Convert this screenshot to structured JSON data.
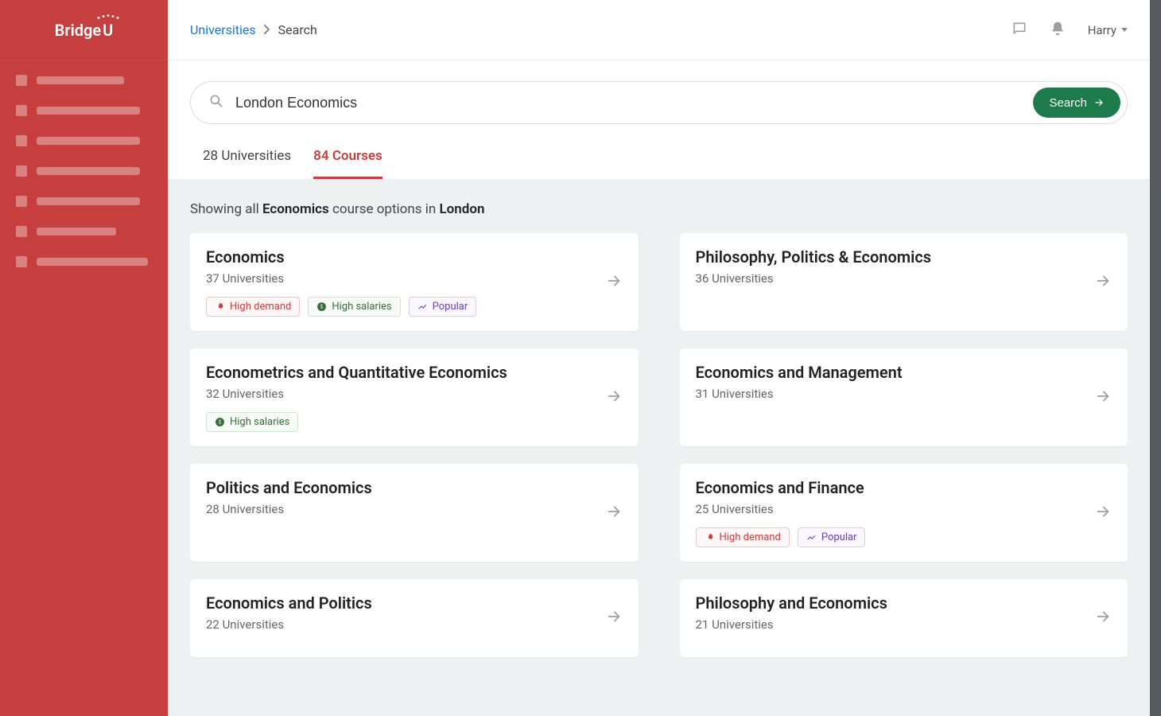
{
  "logo_text": "BridgeU",
  "breadcrumb": {
    "root": "Universities",
    "current": "Search"
  },
  "user": {
    "name": "Harry"
  },
  "search": {
    "value": "London Economics",
    "button": "Search"
  },
  "tabs": {
    "universities_label": "28 Universities",
    "courses_label": "84 Courses"
  },
  "results_heading": {
    "prefix": "Showing all ",
    "subject": "Economics",
    "mid": " course options in ",
    "location": "London"
  },
  "badges": {
    "high_demand": "High demand",
    "high_salaries": "High salaries",
    "popular": "Popular"
  },
  "courses": [
    {
      "title": "Economics",
      "sub": "37 Universities",
      "tags": [
        "demand",
        "salary",
        "popular"
      ]
    },
    {
      "title": "Philosophy, Politics & Economics",
      "sub": "36 Universities",
      "tags": []
    },
    {
      "title": "Econometrics and Quantitative Economics",
      "sub": "32 Universities",
      "tags": [
        "salary"
      ]
    },
    {
      "title": "Economics and Management",
      "sub": "31 Universities",
      "tags": []
    },
    {
      "title": "Politics and Economics",
      "sub": "28 Universities",
      "tags": []
    },
    {
      "title": "Economics and Finance",
      "sub": "25 Universities",
      "tags": [
        "demand",
        "popular"
      ]
    },
    {
      "title": "Economics and Politics",
      "sub": "22 Universities",
      "tags": []
    },
    {
      "title": "Philosophy and Economics",
      "sub": "21 Universities",
      "tags": []
    }
  ],
  "sidebar_nav_widths": [
    110,
    130,
    130,
    130,
    130,
    100,
    140
  ]
}
